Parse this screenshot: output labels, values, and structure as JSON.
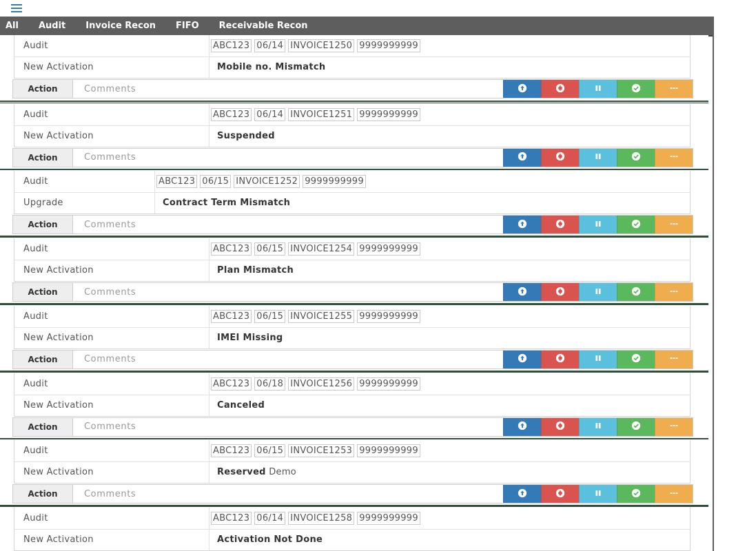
{
  "nav": {
    "tabs": [
      {
        "label": "All"
      },
      {
        "label": "Audit"
      },
      {
        "label": "Invoice Recon"
      },
      {
        "label": "FIFO"
      },
      {
        "label": "Receivable Recon"
      }
    ]
  },
  "records": [
    {
      "type": "Audit",
      "activation": "New Activation",
      "refs": [
        "ABC123",
        "06/14",
        "INVOICE1250",
        "9999999999"
      ],
      "status": "Mobile no. Mismatch",
      "status_extra": ""
    },
    {
      "type": "Audit",
      "activation": "New Activation",
      "refs": [
        "ABC123",
        "06/14",
        "INVOICE1251",
        "9999999999"
      ],
      "status": "Suspended",
      "status_extra": ""
    },
    {
      "type": "Audit",
      "activation": "Upgrade",
      "refs": [
        "ABC123",
        "06/15",
        "INVOICE1252",
        "9999999999"
      ],
      "status": "Contract Term Mismatch",
      "status_extra": ""
    },
    {
      "type": "Audit",
      "activation": "New Activation",
      "refs": [
        "ABC123",
        "06/15",
        "INVOICE1254",
        "9999999999"
      ],
      "status": "Plan Mismatch",
      "status_extra": ""
    },
    {
      "type": "Audit",
      "activation": "New Activation",
      "refs": [
        "ABC123",
        "06/15",
        "INVOICE1255",
        "9999999999"
      ],
      "status": "IMEI Missing",
      "status_extra": ""
    },
    {
      "type": "Audit",
      "activation": "New Activation",
      "refs": [
        "ABC123",
        "06/18",
        "INVOICE1256",
        "9999999999"
      ],
      "status": "Canceled",
      "status_extra": ""
    },
    {
      "type": "Audit",
      "activation": "New Activation",
      "refs": [
        "ABC123",
        "06/15",
        "INVOICE1253",
        "9999999999"
      ],
      "status": "Reserved",
      "status_extra": "Demo"
    },
    {
      "type": "Audit",
      "activation": "New Activation",
      "refs": [
        "ABC123",
        "06/14",
        "INVOICE1258",
        "9999999999"
      ],
      "status": "Activation Not Done",
      "status_extra": ""
    }
  ],
  "action_bar": {
    "label": "Action",
    "comments_placeholder": "Comments",
    "buttons": [
      {
        "name": "upload-button",
        "icon": "arrow-up-circle-icon",
        "color": "#337ab7"
      },
      {
        "name": "reject-button",
        "icon": "dollar-circle-icon",
        "color": "#d9534f"
      },
      {
        "name": "pause-button",
        "icon": "pause-icon",
        "color": "#5bc0de"
      },
      {
        "name": "approve-button",
        "icon": "check-circle-icon",
        "color": "#5cb85c"
      },
      {
        "name": "more-button",
        "icon": "ellipsis-icon",
        "color": "#f0ad4e"
      }
    ]
  },
  "colors": {
    "nav_bg": "#5e5e5e",
    "card_border": "#2e4d3b",
    "accent": "#337ab7"
  }
}
